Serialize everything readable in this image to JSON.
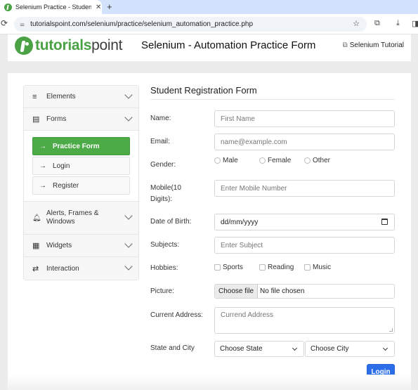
{
  "browser": {
    "tab_title": "Selenium Practice - Student F",
    "tab_close": "✕",
    "new_tab": "+",
    "url": "tutorialspoint.com/selenium/practice/selenium_automation_practice.php",
    "icons": {
      "reload": "⟳",
      "site_info": "⚌",
      "bookmark_star": "☆",
      "extensions": "⧉",
      "download": "⤓",
      "side_panel": "◨"
    }
  },
  "header": {
    "logo_bold": "tutorials",
    "logo_light": "point",
    "title": "Selenium - Automation Practice Form",
    "link_icon": "⧉",
    "link_label": "Selenium Tutorial"
  },
  "sidebar": {
    "sections": [
      {
        "icon": "≡",
        "label": "Elements"
      },
      {
        "icon": "▤",
        "label": "Forms"
      },
      {
        "icon": "🔔",
        "label": "Alerts, Frames & Windows"
      },
      {
        "icon": "▦",
        "label": "Widgets"
      },
      {
        "icon": "⇄",
        "label": "Interaction"
      }
    ],
    "forms_items": [
      {
        "label": "Practice Form",
        "active": true
      },
      {
        "label": "Login",
        "active": false
      },
      {
        "label": "Register",
        "active": false
      }
    ],
    "arrow": "→"
  },
  "form": {
    "title": "Student Registration Form",
    "name": {
      "label": "Name:",
      "placeholder": "First Name"
    },
    "email": {
      "label": "Email:",
      "placeholder": "name@example.com"
    },
    "gender": {
      "label": "Gender:",
      "options": [
        "Male",
        "Female",
        "Other"
      ]
    },
    "mobile": {
      "label_line1": "Mobile(10",
      "label_line2": "Digits):",
      "placeholder": "Enter Mobile Number"
    },
    "dob": {
      "label": "Date of Birth:",
      "value": "dd/mm/yyyy"
    },
    "subjects": {
      "label": "Subjects:",
      "placeholder": "Enter Subject"
    },
    "hobbies": {
      "label": "Hobbies:",
      "options": [
        "Sports",
        "Reading",
        "Music"
      ]
    },
    "picture": {
      "label": "Picture:",
      "button": "Choose file",
      "status": "No file chosen"
    },
    "address": {
      "label": "Current Address:",
      "placeholder": "Currend Address"
    },
    "state_city": {
      "label": "State and City",
      "state": "Choose State",
      "city": "Choose City"
    },
    "submit": "Login"
  },
  "colors": {
    "brand_green": "#4aa245",
    "active_green": "#4caa47",
    "primary_blue": "#2b6ee8"
  }
}
